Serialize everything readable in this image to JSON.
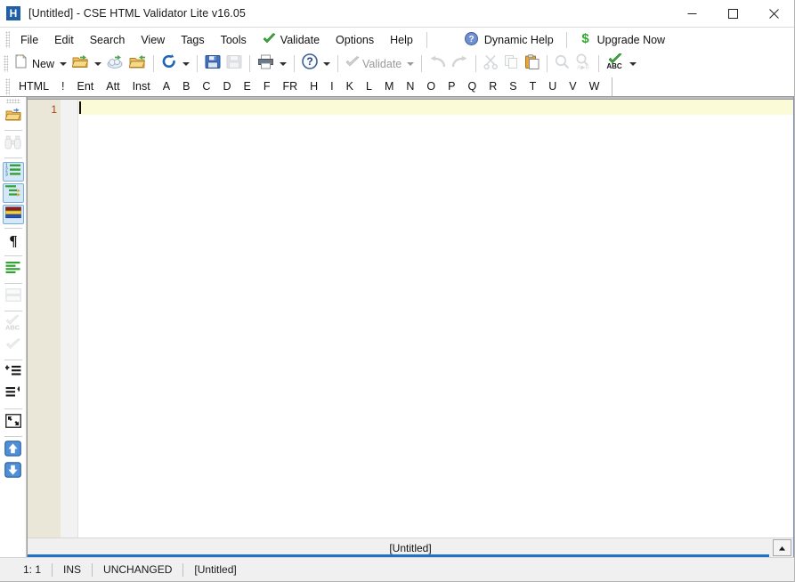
{
  "window": {
    "title": "[Untitled] - CSE HTML Validator Lite v16.05",
    "app_icon": "h-logo-icon",
    "minimize_label": "Minimize",
    "maximize_label": "Maximize",
    "close_label": "Close"
  },
  "menubar": {
    "items": [
      {
        "label": "File",
        "icon": ""
      },
      {
        "label": "Edit",
        "icon": ""
      },
      {
        "label": "Search",
        "icon": ""
      },
      {
        "label": "View",
        "icon": ""
      },
      {
        "label": "Tags",
        "icon": ""
      },
      {
        "label": "Tools",
        "icon": ""
      },
      {
        "label": "Validate",
        "icon": "green-check-icon"
      },
      {
        "label": "Options",
        "icon": ""
      },
      {
        "label": "Help",
        "icon": ""
      }
    ],
    "right_items": [
      {
        "label": "Dynamic Help",
        "icon": "blue-question-icon"
      },
      {
        "label": "Upgrade Now",
        "icon": "green-dollar-icon"
      }
    ]
  },
  "toolbar": {
    "new_label": "New",
    "validate_label": "Validate",
    "buttons": [
      {
        "name": "new-document",
        "icon": "new-page-icon",
        "enabled": true
      },
      {
        "name": "open-file",
        "icon": "open-folder-icon",
        "enabled": true
      },
      {
        "name": "open-from-web",
        "icon": "cloud-open-icon",
        "enabled": true
      },
      {
        "name": "reopen-file",
        "icon": "folder-reopen-icon",
        "enabled": true
      },
      {
        "name": "reload",
        "icon": "refresh-circle-icon",
        "enabled": true
      },
      {
        "name": "save",
        "icon": "floppy-save-icon",
        "enabled": true
      },
      {
        "name": "save-all",
        "icon": "floppy-save-all-icon",
        "enabled": false
      },
      {
        "name": "print",
        "icon": "printer-icon",
        "enabled": true
      },
      {
        "name": "help",
        "icon": "question-circle-icon",
        "enabled": true
      },
      {
        "name": "validate",
        "icon": "grey-check-icon",
        "enabled": false
      },
      {
        "name": "undo",
        "icon": "undo-arrow-icon",
        "enabled": false
      },
      {
        "name": "redo",
        "icon": "redo-arrow-icon",
        "enabled": false
      },
      {
        "name": "cut",
        "icon": "scissors-icon",
        "enabled": false
      },
      {
        "name": "copy",
        "icon": "copy-pages-icon",
        "enabled": false
      },
      {
        "name": "paste",
        "icon": "clipboard-paste-icon",
        "enabled": true
      },
      {
        "name": "find",
        "icon": "magnifier-icon",
        "enabled": false
      },
      {
        "name": "replace",
        "icon": "magnifier-replace-icon",
        "enabled": false
      },
      {
        "name": "spell-check",
        "icon": "spellcheck-abc-icon",
        "enabled": true
      }
    ]
  },
  "tagbar": {
    "items": [
      "HTML",
      "!",
      "Ent",
      "Att",
      "Inst",
      "A",
      "B",
      "C",
      "D",
      "E",
      "F",
      "FR",
      "H",
      "I",
      "K",
      "L",
      "M",
      "N",
      "O",
      "P",
      "Q",
      "R",
      "S",
      "T",
      "U",
      "V",
      "W"
    ]
  },
  "sidebar": {
    "items": [
      {
        "name": "open-document",
        "icon": "folder-open-icon",
        "active": false,
        "enabled": true
      },
      {
        "name": "find-binoculars",
        "icon": "binoculars-icon",
        "active": false,
        "enabled": false
      },
      {
        "name": "numbered-list",
        "icon": "ordered-list-icon",
        "active": true,
        "enabled": true
      },
      {
        "name": "nested-list",
        "icon": "tree-list-icon",
        "active": true,
        "enabled": true
      },
      {
        "name": "color-bars",
        "icon": "color-bars-icon",
        "active": true,
        "enabled": true
      },
      {
        "name": "paragraph-marks",
        "icon": "pilcrow-icon",
        "active": false,
        "enabled": true
      },
      {
        "name": "green-lines",
        "icon": "green-lines-icon",
        "active": false,
        "enabled": true
      },
      {
        "name": "split-view",
        "icon": "split-panes-icon",
        "active": false,
        "enabled": false
      },
      {
        "name": "spell-check-abc",
        "icon": "spellcheck-abc-icon",
        "active": false,
        "enabled": false
      },
      {
        "name": "check-mark",
        "icon": "grey-check-icon",
        "active": false,
        "enabled": false
      },
      {
        "name": "indent-increase",
        "icon": "indent-increase-icon",
        "active": false,
        "enabled": true
      },
      {
        "name": "indent-decrease",
        "icon": "indent-decrease-icon",
        "active": false,
        "enabled": true
      },
      {
        "name": "full-screen",
        "icon": "fullscreen-arrows-icon",
        "active": false,
        "enabled": true
      },
      {
        "name": "move-up",
        "icon": "blue-up-arrow-icon",
        "active": false,
        "enabled": true
      },
      {
        "name": "move-down",
        "icon": "blue-down-arrow-icon",
        "active": false,
        "enabled": true
      }
    ]
  },
  "editor": {
    "line_numbers": [
      "1"
    ],
    "lines": [
      ""
    ],
    "current_line": 1
  },
  "tabstrip": {
    "active_tab": "[Untitled]",
    "scroll_button_icon": "triangle-up-icon"
  },
  "statusbar": {
    "cursor_position": "1: 1",
    "insert_mode": "INS",
    "modified_state": "UNCHANGED",
    "document_name": "[Untitled]"
  },
  "colors": {
    "accent_blue": "#1f72c8",
    "title_icon_blue": "#1f5fa9",
    "gutter_beige": "#eae7d8",
    "current_line_yellow": "#fbfbd8",
    "line_number_red": "#a4450f",
    "validate_green": "#2eab2e",
    "sidebar_active_blue": "#d4e8f7"
  }
}
